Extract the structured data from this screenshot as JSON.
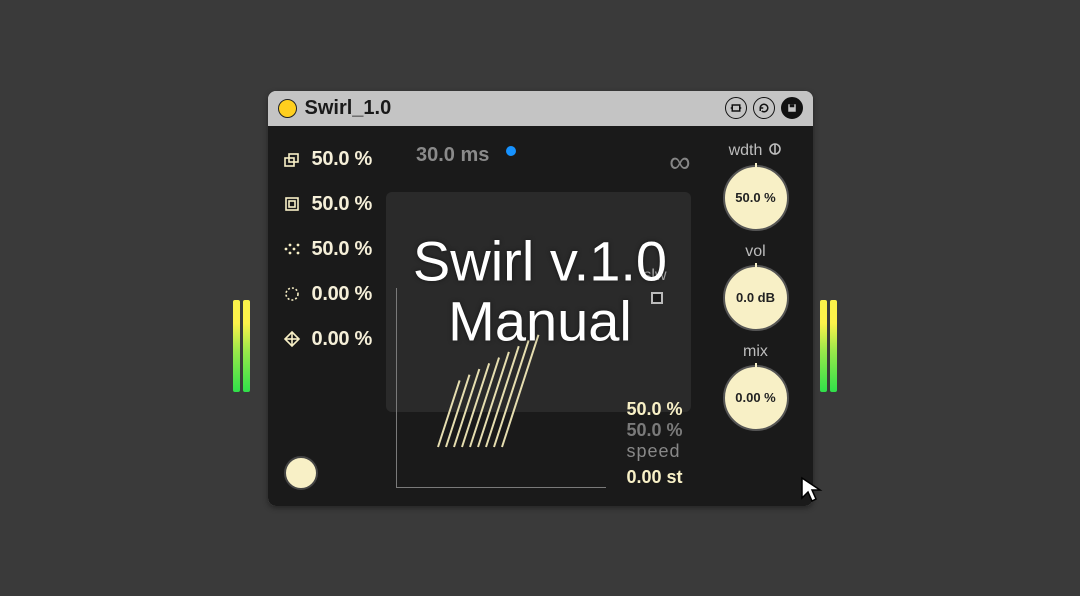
{
  "device": {
    "title": "Swirl_1.0",
    "colors": {
      "accent": "#ffcf1e",
      "cream": "#F8F0C6",
      "modDot": "#1692ff"
    }
  },
  "params": [
    {
      "label": "50.0 %"
    },
    {
      "label": "50.0 %"
    },
    {
      "label": "50.0 %"
    },
    {
      "label": "0.00 %"
    },
    {
      "label": "0.00 %"
    }
  ],
  "center": {
    "timeLabel": "30.0 ms",
    "slwLabel": "slw",
    "fbValue1": "50.0 %",
    "fbValue2": "50.0 %",
    "speedLabel": "speed",
    "tuneValue": "0.00 st"
  },
  "knobs": {
    "width": {
      "label": "wdth",
      "value": "50.0 %"
    },
    "vol": {
      "label": "vol",
      "value": "0.0 dB"
    },
    "mix": {
      "label": "mix",
      "value": "0.00 %"
    }
  },
  "overlay": {
    "line1": "Swirl v.1.0",
    "line2": "Manual"
  }
}
